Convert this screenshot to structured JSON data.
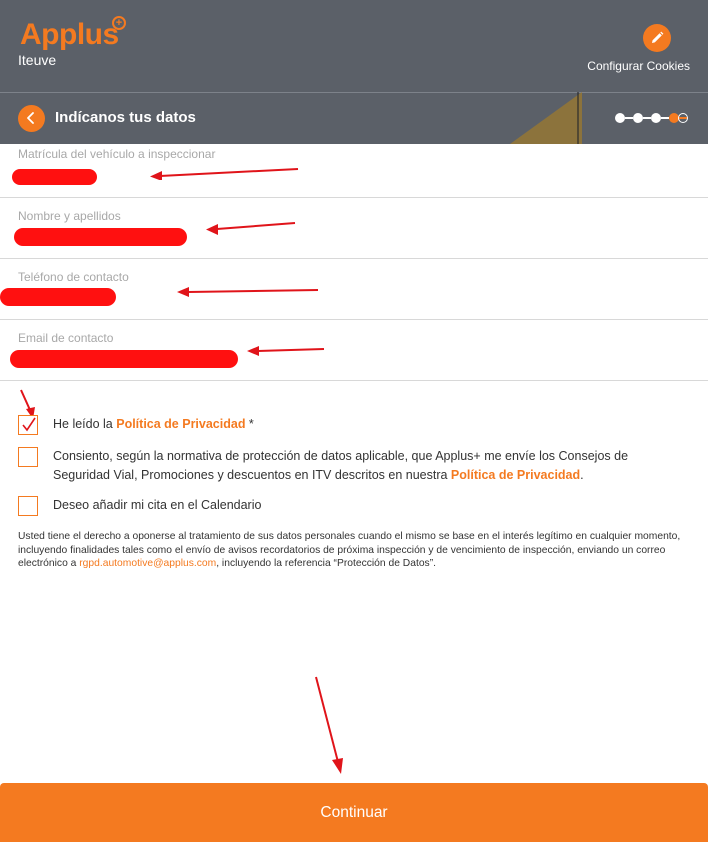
{
  "header": {
    "logo_text": "Applus",
    "logo_plus": "+",
    "subtitle": "Iteuve",
    "cookies_label": "Configurar Cookies"
  },
  "bar": {
    "title": "Indícanos tus datos",
    "steps_total": 5,
    "step_current": 4
  },
  "form": {
    "plate_label": "Matrícula del vehículo a inspeccionar",
    "name_label": "Nombre y apellidos",
    "phone_label": "Teléfono de contacto",
    "email_label": "Email de contacto"
  },
  "checks": {
    "privacy_prefix": "He leído la ",
    "privacy_link": "Política de Privacidad",
    "privacy_suffix": " *",
    "privacy_checked": true,
    "consent_text": "Consiento, según la normativa de protección de datos aplicable, que Applus+ me envíe los Consejos de Seguridad Vial, Promociones y descuentos en ITV descritos en nuestra ",
    "consent_link": "Política de Privacidad",
    "consent_suffix": ".",
    "consent_checked": false,
    "calendar_text": "Deseo añadir mi cita en el Calendario",
    "calendar_checked": false
  },
  "legal": {
    "text_before": "Usted tiene el derecho a oponerse al tratamiento de sus datos personales cuando el mismo se base en el interés legítimo en cualquier momento, incluyendo finalidades tales como el envío de avisos recordatorios de próxima inspección y de vencimiento de inspección, enviando un correo electrónico a ",
    "email": "rgpd.automotive@applus.com",
    "text_after": ", incluyendo la referencia “Protección de Datos”."
  },
  "continue_label": "Continuar",
  "colors": {
    "accent": "#f47a20",
    "header_bg": "#5b6068",
    "annotation_red": "#e0141a"
  }
}
